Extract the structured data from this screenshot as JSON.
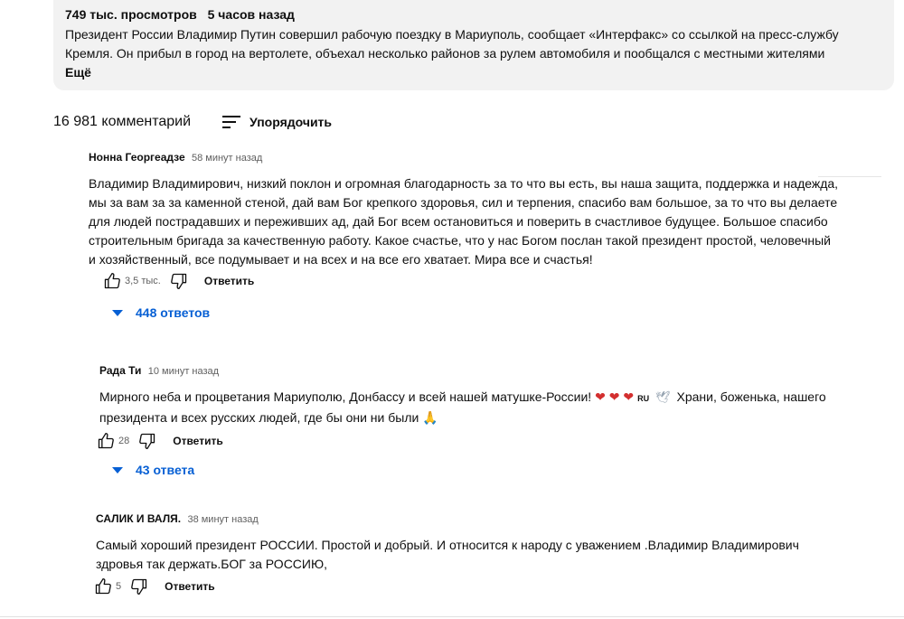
{
  "description": {
    "views": "749 тыс. просмотров",
    "time": "5 часов назад",
    "text": "Президент России Владимир Путин совершил рабочую поездку в Мариуполь, сообщает «Интерфакс» со ссылкой на пресс-службу Кремля. Он прибыл в город на вертолете, объехал несколько районов за рулем автомобиля и пообщался с местными жителями",
    "more_label": "Ещё"
  },
  "comments_header": {
    "count": "16 981 комментарий",
    "sort_label": "Упорядочить"
  },
  "comments": [
    {
      "author": "Нонна Георгеадзе",
      "time": "58 минут назад",
      "text": "Владимир Владимирович, низкий поклон и огромная благодарность за то что вы есть, вы наша защита, поддержка и надежда, мы за вам за за каменной стеной, дай вам Бог крепкого здоровья, сил и терпения, спасибо вам большое, за то что вы делаете для людей пострадавших и переживших ад, дай Бог всем остановиться и поверить в счастливое будущее. Большое спасибо строительным бригада за качественную работу. Какое счастье, что у нас Богом послан такой президент простой, человечный и хозяйственный, все подумывает и на всех и на все его хватает. Мира все и счастья!",
      "likes": "3,5 тыс.",
      "reply_label": "Ответить",
      "replies_label": "448 ответов"
    },
    {
      "author": "Рада Ти",
      "time": "10 минут назад",
      "text_part1": "Мирного неба и процветания Мариуполю, Донбассу и всей нашей матушке-России!",
      "ru_flag": "RU",
      "text_part2": "Храни, боженька, нашего президента и всех русских людей, где бы они ни были",
      "likes": "28",
      "reply_label": "Ответить",
      "replies_label": "43 ответа"
    },
    {
      "author": "САЛИК И ВАЛЯ.",
      "time": "38 минут назад",
      "text": "Самый хороший президент РОССИИ. Простой и добрый. И относится к народу с уважением .Владимир Владимирович здровья так держать.БОГ  за РОССИЮ,",
      "likes": "5",
      "reply_label": "Ответить"
    }
  ],
  "colors": {
    "link": "#065fd4",
    "muted": "#606060",
    "panel": "#f2f2f2"
  }
}
